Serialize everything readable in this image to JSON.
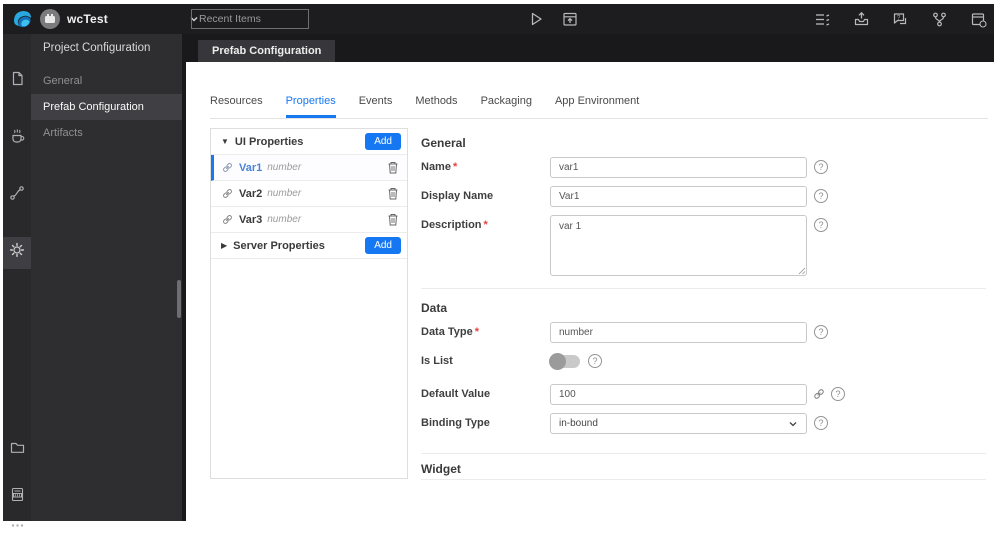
{
  "topbar": {
    "project_name": "wcTest",
    "recent_items_placeholder": "Recent Items"
  },
  "nav": {
    "title": "Project Configuration",
    "items": [
      {
        "label": "General"
      },
      {
        "label": "Prefab Configuration",
        "active": true
      },
      {
        "label": "Artifacts"
      }
    ]
  },
  "page_tab": {
    "label": "Prefab Configuration"
  },
  "tabs": {
    "active": "Properties",
    "items": [
      "Resources",
      "Properties",
      "Events",
      "Methods",
      "Packaging",
      "App Environment"
    ]
  },
  "properties_panel": {
    "ui_group": {
      "caret": "▼",
      "label": "UI Properties",
      "add_label": "Add"
    },
    "items": [
      {
        "name": "Var1",
        "type": "number",
        "active": true
      },
      {
        "name": "Var2",
        "type": "number"
      },
      {
        "name": "Var3",
        "type": "number"
      }
    ],
    "server_group": {
      "caret": "▶",
      "label": "Server Properties",
      "add_label": "Add"
    }
  },
  "form": {
    "required_marker": "*",
    "help_glyph": "?",
    "general": {
      "title": "General",
      "name": {
        "label": "Name",
        "required": true,
        "value": "var1"
      },
      "display_name": {
        "label": "Display Name",
        "required": false,
        "value": "Var1"
      },
      "description": {
        "label": "Description",
        "required": true,
        "value": "var 1"
      }
    },
    "data": {
      "title": "Data",
      "data_type": {
        "label": "Data Type",
        "required": true,
        "value": "number"
      },
      "is_list": {
        "label": "Is List",
        "state": "off"
      },
      "default_value": {
        "label": "Default Value",
        "value": "100"
      },
      "binding_type": {
        "label": "Binding Type",
        "value": "in-bound"
      }
    },
    "widget": {
      "title": "Widget"
    }
  },
  "colors": {
    "accent_blue": "#1778f2",
    "required_red": "#e5413e",
    "topbar_bg": "#1d1d1f"
  },
  "icons": [
    "wavemaker-logo",
    "chevron-down-icon",
    "play-icon",
    "app-preview-icon",
    "list-settings-icon",
    "export-icon",
    "feedback-chat-icon",
    "fork-icon",
    "window-switch-icon",
    "file-icon",
    "java-services-icon",
    "api-connector-icon",
    "gear-icon",
    "folder-icon",
    "log-file-icon",
    "more-icon",
    "link-icon",
    "trash-icon",
    "help-icon"
  ]
}
